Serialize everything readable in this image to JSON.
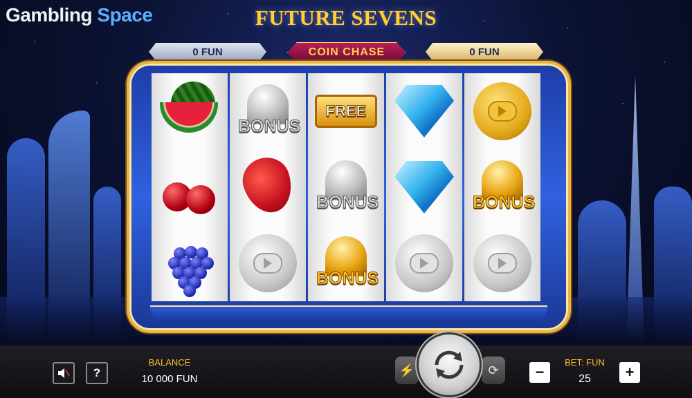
{
  "brand": {
    "part1": "Gambling",
    "part2": "Space"
  },
  "game_title": "FUTURE SEVENS",
  "top_bars": {
    "left_value": "0 FUN",
    "center_label": "COIN CHASE",
    "right_value": "0 FUN"
  },
  "reels": [
    [
      "watermelon",
      "cherry",
      "grapes"
    ],
    [
      "silver-bell-bonus",
      "strawberry",
      "silver-coin"
    ],
    [
      "free",
      "silver-bell-bonus",
      "gold-bell-bonus"
    ],
    [
      "diamond",
      "diamond",
      "silver-coin"
    ],
    [
      "gold-coin",
      "gold-bell-bonus",
      "silver-coin"
    ]
  ],
  "symbol_text": {
    "bonus": "BONUS",
    "free": "FREE"
  },
  "panel": {
    "sound_icon": "speaker-muted-icon",
    "help_label": "?",
    "balance_label": "BALANCE",
    "balance_value": "10 000 FUN",
    "bet_label": "BET: FUN",
    "bet_value": "25",
    "minus_label": "−",
    "plus_label": "+"
  },
  "colors": {
    "accent_gold": "#ffbd2e",
    "frame_blue": "#3061e0",
    "coin_chase": "#b81e5c"
  }
}
